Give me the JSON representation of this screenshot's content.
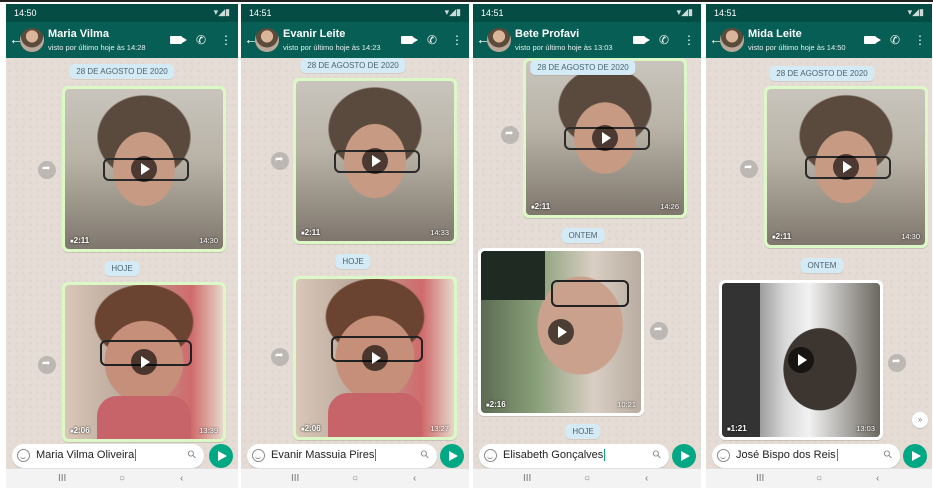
{
  "panels": [
    {
      "status_time": "14:50",
      "contact_name": "Maria Vilma",
      "last_seen": "visto por último hoje às 14:28",
      "date_pill": "28 DE AGOSTO DE 2020",
      "video1": {
        "duration": "2:11",
        "time": "14:30"
      },
      "day_pill": "HOJE",
      "video2": {
        "duration": "2:06",
        "time": "13:39"
      },
      "input_text": "Maria Vilma Oliveira"
    },
    {
      "status_time": "14:51",
      "contact_name": "Evanir Leite",
      "last_seen": "visto por último hoje às 14:23",
      "date_pill": "28 DE AGOSTO DE 2020",
      "video1": {
        "duration": "2:11",
        "time": "14:33"
      },
      "day_pill": "HOJE",
      "video2": {
        "duration": "2:06",
        "time": "13:27"
      },
      "input_text": "Evanir Massuia Pires"
    },
    {
      "status_time": "14:51",
      "contact_name": "Bete Profavi",
      "last_seen": "visto por último hoje às 13:03",
      "date_pill": "28 DE AGOSTO DE 2020",
      "video1": {
        "duration": "2:11",
        "time": "14:26"
      },
      "day_pill": "ONTEM",
      "video2": {
        "duration": "2:16",
        "time": "10:21"
      },
      "day_pill2": "HOJE",
      "input_text": "Elisabeth Gonçalves"
    },
    {
      "status_time": "14:51",
      "contact_name": "Mida Leite",
      "last_seen": "visto por último hoje às 14:50",
      "date_pill": "28 DE AGOSTO DE 2020",
      "video1": {
        "duration": "2:11",
        "time": "14:30"
      },
      "day_pill": "ONTEM",
      "video2": {
        "duration": "1:21",
        "time": "13:03"
      },
      "input_text": "José Bispo dos Reis"
    }
  ],
  "icons": {
    "back": "arrow-left-icon",
    "video_call": "video-camera-icon",
    "voice_call": "phone-icon",
    "menu": "more-vertical-icon",
    "emoji": "smiley-icon",
    "attach": "paperclip-icon",
    "send": "send-icon",
    "share": "forward-icon",
    "play": "play-icon"
  },
  "colors": {
    "header": "#075e54",
    "status_bar": "#054d44",
    "outgoing_bubble": "#dcf8c6",
    "chat_background": "#e5ddd5",
    "send_button": "#00a884",
    "date_pill": "#d4eaf4"
  },
  "nav": {
    "recents": "III",
    "home": "○",
    "back": "‹"
  }
}
